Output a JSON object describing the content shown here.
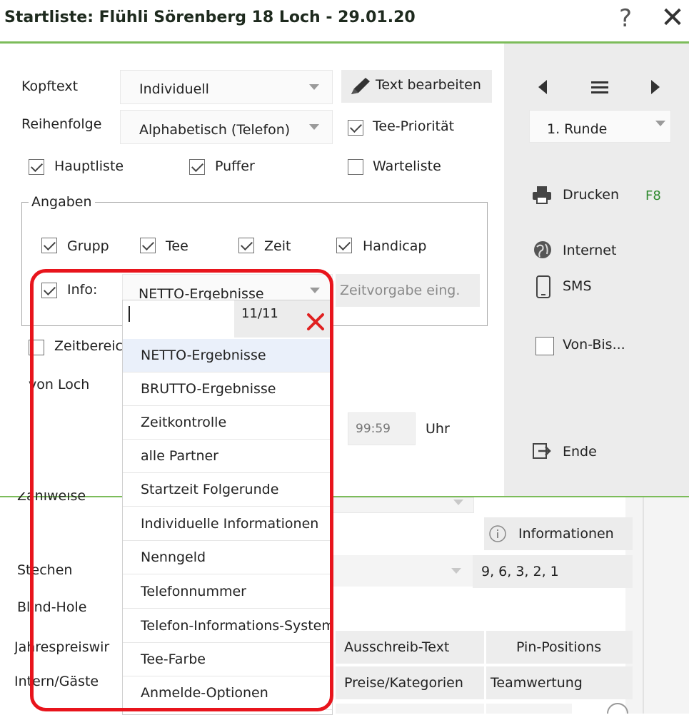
{
  "window": {
    "title": "Startliste: Flühli Sörenberg 18 Loch - 29.01.20",
    "help": "?",
    "close": "✕"
  },
  "form": {
    "kopftext_label": "Kopftext",
    "kopftext_value": "Individuell",
    "text_bearbeiten": "Text bearbeiten",
    "reihenfolge_label": "Reihenfolge",
    "reihenfolge_value": "Alphabetisch (Telefon)",
    "tee_prioritaet": "Tee-Priorität",
    "hauptliste": "Hauptliste",
    "puffer": "Puffer",
    "warteliste": "Warteliste",
    "angaben": "Angaben",
    "grupp": "Grupp",
    "tee": "Tee",
    "zeit": "Zeit",
    "handicap": "Handicap",
    "info": "Info:",
    "info_value": "NETTO-Ergebnisse",
    "zeitvorgabe": "Zeitvorgabe eing.",
    "zeitbereich": "Zeitbereich",
    "von_loch": "von Loch",
    "time_value": "99:59",
    "uhr": "Uhr"
  },
  "side": {
    "runde": "1. Runde",
    "drucken": "Drucken",
    "drucken_key": "F8",
    "internet": "Internet",
    "sms": "SMS",
    "von_bis": "Von-Bis...",
    "ende": "Ende"
  },
  "lower": {
    "zaehlweise": "Zählweise",
    "informationen": "Informationen",
    "stechen": "Stechen",
    "stechen_value": "9, 6, 3, 2, 1",
    "blind_hole": "Blind-Hole",
    "jahrespreiswertung": "Jahrespreiswir",
    "ausschreib_text": "Ausschreib-Text",
    "pin_positions": "Pin-Positions",
    "intern_gaeste": "Intern/Gäste",
    "preise_kategorien": "Preise/Kategorien",
    "teamwertung": "Teamwertung"
  },
  "dropdown": {
    "search_value": "",
    "counter": "11/11",
    "items": [
      "NETTO-Ergebnisse",
      "BRUTTO-Ergebnisse",
      "Zeitkontrolle",
      "alle Partner",
      "Startzeit Folgerunde",
      "Individuelle Informationen",
      "Nenngeld",
      "Telefonnummer",
      "Telefon-Informations-System",
      "Tee-Farbe",
      "Anmelde-Optionen"
    ]
  },
  "colors": {
    "accent_green": "#7cbc5a",
    "highlight_red": "#e8141c",
    "panel_gray": "#ececec"
  }
}
